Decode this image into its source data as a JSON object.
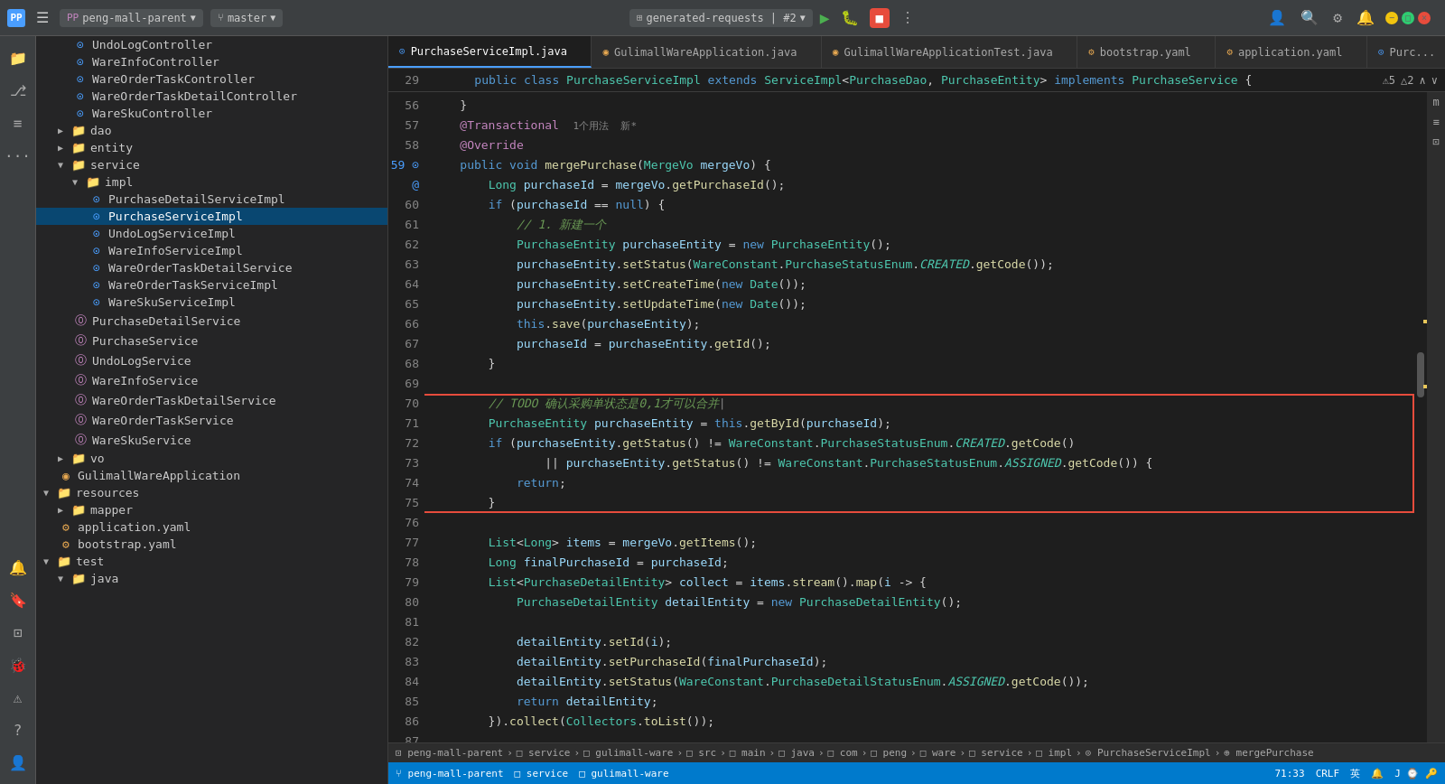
{
  "titlebar": {
    "logo": "PP",
    "project": "peng-mall-parent",
    "branch": "master",
    "run_config": "generated-requests | #2",
    "menu_icon": "☰"
  },
  "tabs": [
    {
      "label": "PurchaseServiceImpl.java",
      "active": true,
      "icon": "C",
      "close": "×"
    },
    {
      "label": "GulimallWareApplication.java",
      "active": false,
      "icon": "G",
      "close": "×"
    },
    {
      "label": "GulimallWareApplicationTest.java",
      "active": false,
      "icon": "G",
      "close": "×"
    },
    {
      "label": "bootstrap.yaml",
      "active": false,
      "icon": "Y",
      "close": "×"
    },
    {
      "label": "application.yaml",
      "active": false,
      "icon": "Y",
      "close": "×"
    },
    {
      "label": "Purc...",
      "active": false,
      "icon": "C",
      "close": "×"
    }
  ],
  "tree": {
    "items": [
      {
        "label": "UndoLogController",
        "indent": 2,
        "type": "java",
        "expanded": false
      },
      {
        "label": "WareInfoController",
        "indent": 2,
        "type": "java",
        "expanded": false
      },
      {
        "label": "WareOrderTaskController",
        "indent": 2,
        "type": "java",
        "expanded": false
      },
      {
        "label": "WareOrderTaskDetailController",
        "indent": 2,
        "type": "java",
        "expanded": false
      },
      {
        "label": "WareSkuController",
        "indent": 2,
        "type": "java",
        "expanded": false
      },
      {
        "label": "dao",
        "indent": 1,
        "type": "folder",
        "expanded": false
      },
      {
        "label": "entity",
        "indent": 1,
        "type": "folder",
        "expanded": false
      },
      {
        "label": "service",
        "indent": 1,
        "type": "folder",
        "expanded": true
      },
      {
        "label": "impl",
        "indent": 2,
        "type": "folder",
        "expanded": true
      },
      {
        "label": "PurchaseDetailServiceImpl",
        "indent": 3,
        "type": "java",
        "expanded": false
      },
      {
        "label": "PurchaseServiceImpl",
        "indent": 3,
        "type": "java",
        "expanded": false,
        "active": true
      },
      {
        "label": "UndoLogServiceImpl",
        "indent": 3,
        "type": "java",
        "expanded": false
      },
      {
        "label": "WareInfoServiceImpl",
        "indent": 3,
        "type": "java",
        "expanded": false
      },
      {
        "label": "WareOrderTaskDetailService",
        "indent": 3,
        "type": "java",
        "expanded": false
      },
      {
        "label": "WareOrderTaskServiceImpl",
        "indent": 3,
        "type": "java",
        "expanded": false
      },
      {
        "label": "WareSkuServiceImpl",
        "indent": 3,
        "type": "java",
        "expanded": false
      },
      {
        "label": "PurchaseDetailService",
        "indent": 2,
        "type": "service",
        "expanded": false
      },
      {
        "label": "PurchaseService",
        "indent": 2,
        "type": "service",
        "expanded": false
      },
      {
        "label": "UndoLogService",
        "indent": 2,
        "type": "service",
        "expanded": false
      },
      {
        "label": "WareInfoService",
        "indent": 2,
        "type": "service",
        "expanded": false
      },
      {
        "label": "WareOrderTaskDetailService",
        "indent": 2,
        "type": "service",
        "expanded": false
      },
      {
        "label": "WareOrderTaskService",
        "indent": 2,
        "type": "service",
        "expanded": false
      },
      {
        "label": "WareSkuService",
        "indent": 2,
        "type": "service",
        "expanded": false
      },
      {
        "label": "vo",
        "indent": 1,
        "type": "folder",
        "expanded": false
      },
      {
        "label": "GulimallWareApplication",
        "indent": 1,
        "type": "java-app",
        "expanded": false
      },
      {
        "label": "resources",
        "indent": 0,
        "type": "folder",
        "expanded": true
      },
      {
        "label": "mapper",
        "indent": 1,
        "type": "folder",
        "expanded": false
      },
      {
        "label": "application.yaml",
        "indent": 1,
        "type": "yaml",
        "expanded": false
      },
      {
        "label": "bootstrap.yaml",
        "indent": 1,
        "type": "yaml",
        "expanded": false
      },
      {
        "label": "test",
        "indent": 0,
        "type": "folder",
        "expanded": true
      },
      {
        "label": "java",
        "indent": 1,
        "type": "folder",
        "expanded": true
      }
    ]
  },
  "code": {
    "class_header": "public class PurchaseServiceImpl extends ServiceImpl<PurchaseDao, PurchaseEntity> implements PurchaseService {",
    "lines": [
      {
        "num": 29,
        "content": "    public class PurchaseServiceImpl extends ServiceImpl<PurchaseDao, PurchaseEntity> implements PurchaseService {",
        "type": "header"
      },
      {
        "num": 56,
        "content": "    }",
        "type": "normal"
      },
      {
        "num": 57,
        "content": "@Transactional  1个用法  新*",
        "type": "annotation-line"
      },
      {
        "num": 58,
        "content": "@Override",
        "type": "annotation-line2"
      },
      {
        "num": 59,
        "content": "    public void mergePurchase(MergeVo mergeVo) {",
        "type": "method"
      },
      {
        "num": 60,
        "content": "        Long purchaseId = mergeVo.getPurchaseId();",
        "type": "normal"
      },
      {
        "num": 61,
        "content": "        if (purchaseId == null) {",
        "type": "normal"
      },
      {
        "num": 62,
        "content": "            // 1. 新建一个",
        "type": "comment"
      },
      {
        "num": 63,
        "content": "            PurchaseEntity purchaseEntity = new PurchaseEntity();",
        "type": "normal"
      },
      {
        "num": 64,
        "content": "            purchaseEntity.setStatus(WareConstant.PurchaseStatusEnum.CREATED.getCode());",
        "type": "normal"
      },
      {
        "num": 65,
        "content": "            purchaseEntity.setCreateTime(new Date());",
        "type": "normal"
      },
      {
        "num": 66,
        "content": "            purchaseEntity.setUpdateTime(new Date());",
        "type": "normal"
      },
      {
        "num": 67,
        "content": "            this.save(purchaseEntity);",
        "type": "normal"
      },
      {
        "num": 68,
        "content": "            purchaseId = purchaseEntity.getId();",
        "type": "normal"
      },
      {
        "num": 69,
        "content": "        }",
        "type": "normal"
      },
      {
        "num": 70,
        "content": "",
        "type": "empty"
      },
      {
        "num": 71,
        "content": "        // TODO 确认采购单状态是0,1才可以合并",
        "type": "todo"
      },
      {
        "num": 72,
        "content": "        PurchaseEntity purchaseEntity = this.getById(purchaseId);",
        "type": "normal"
      },
      {
        "num": 73,
        "content": "        if (purchaseEntity.getStatus() != WareConstant.PurchaseStatusEnum.CREATED.getCode()",
        "type": "normal"
      },
      {
        "num": 74,
        "content": "                || purchaseEntity.getStatus() != WareConstant.PurchaseStatusEnum.ASSIGNED.getCode()) {",
        "type": "normal"
      },
      {
        "num": 75,
        "content": "            return;",
        "type": "normal"
      },
      {
        "num": 76,
        "content": "        }",
        "type": "normal"
      },
      {
        "num": 77,
        "content": "",
        "type": "empty"
      },
      {
        "num": 78,
        "content": "        List<Long> items = mergeVo.getItems();",
        "type": "normal"
      },
      {
        "num": 79,
        "content": "        Long finalPurchaseId = purchaseId;",
        "type": "normal"
      },
      {
        "num": 80,
        "content": "        List<PurchaseDetailEntity> collect = items.stream().map(i -> {",
        "type": "normal"
      },
      {
        "num": 81,
        "content": "            PurchaseDetailEntity detailEntity = new PurchaseDetailEntity();",
        "type": "normal"
      },
      {
        "num": 82,
        "content": "",
        "type": "empty"
      },
      {
        "num": 83,
        "content": "            detailEntity.setId(i);",
        "type": "normal"
      },
      {
        "num": 84,
        "content": "            detailEntity.setPurchaseId(finalPurchaseId);",
        "type": "normal"
      },
      {
        "num": 85,
        "content": "            detailEntity.setStatus(WareConstant.PurchaseDetailStatusEnum.ASSIGNED.getCode());",
        "type": "normal"
      },
      {
        "num": 86,
        "content": "            return detailEntity;",
        "type": "normal"
      },
      {
        "num": 87,
        "content": "        }).collect(Collectors.toList());",
        "type": "normal"
      }
    ]
  },
  "breadcrumb": {
    "items": [
      "peng-mall-parent",
      "service",
      "gulimall-ware",
      "src",
      "main",
      "java",
      "com",
      "peng",
      "ware",
      "service",
      "impl",
      "PurchaseServiceImpl",
      "mergePurchase"
    ]
  },
  "status": {
    "line_col": "71:33",
    "encoding": "CRLF",
    "lang": "英"
  },
  "warnings": {
    "errors": 5,
    "warnings": 2
  }
}
